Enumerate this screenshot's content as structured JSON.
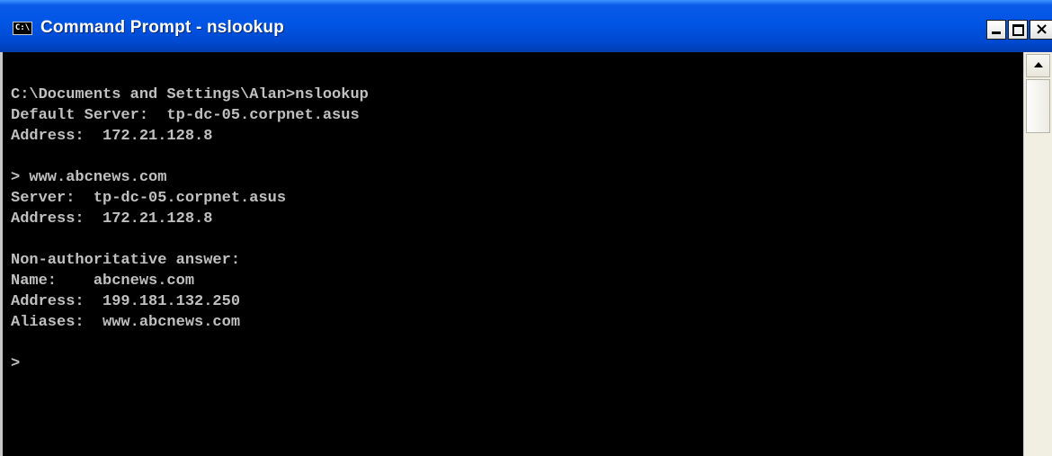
{
  "window": {
    "title": "Command Prompt - nslookup",
    "icon_label": "C:\\"
  },
  "title_buttons": {
    "close_glyph": "×"
  },
  "console": {
    "lines": [
      "C:\\Documents and Settings\\Alan>nslookup",
      "Default Server:  tp-dc-05.corpnet.asus",
      "Address:  172.21.128.8",
      "",
      "> www.abcnews.com",
      "Server:  tp-dc-05.corpnet.asus",
      "Address:  172.21.128.8",
      "",
      "Non-authoritative answer:",
      "Name:    abcnews.com",
      "Address:  199.181.132.250",
      "Aliases:  www.abcnews.com",
      "",
      ">"
    ]
  },
  "icons": {
    "app": "command-prompt-icon",
    "minimize": "minimize-icon",
    "maximize": "maximize-icon",
    "close": "close-icon",
    "scroll_up": "arrow-up-icon"
  }
}
